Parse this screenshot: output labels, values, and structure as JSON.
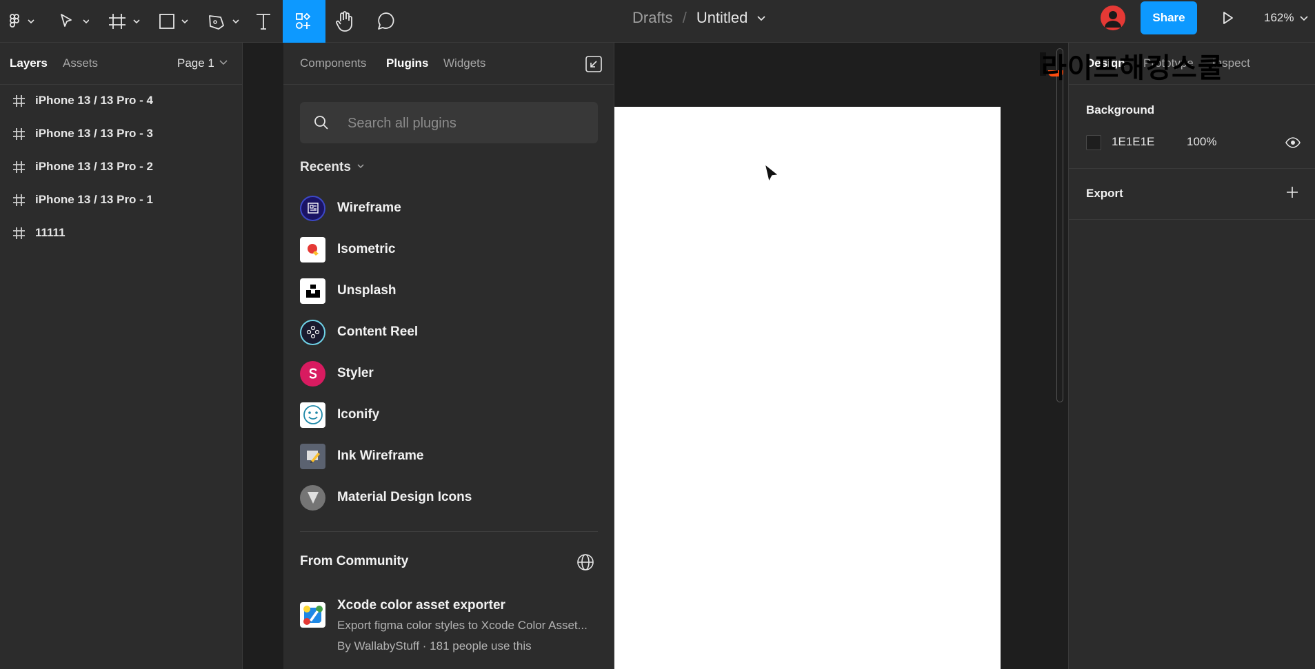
{
  "toolbar": {
    "file_breadcrumb": "Drafts",
    "file_name": "Untitled",
    "share_label": "Share",
    "zoom": "162%",
    "tools": [
      "main-menu-icon",
      "move-icon",
      "frame-icon",
      "rectangle-icon",
      "pen-icon",
      "text-icon",
      "resources-icon",
      "hand-icon",
      "comment-icon"
    ],
    "active_tool": "resources-icon",
    "accent": "#0d99ff"
  },
  "left_panel": {
    "tabs": [
      "Layers",
      "Assets"
    ],
    "page": "Page 1",
    "layers": [
      "iPhone 13 / 13 Pro - 4",
      "iPhone 13 / 13 Pro - 3",
      "iPhone 13 / 13 Pro - 2",
      "iPhone 13 / 13 Pro - 1",
      "11111"
    ]
  },
  "plugins_panel": {
    "tabs": [
      "Components",
      "Plugins",
      "Widgets"
    ],
    "active_tab": "Plugins",
    "search_placeholder": "Search all plugins",
    "recents_label": "Recents",
    "recents": [
      "Wireframe",
      "Isometric",
      "Unsplash",
      "Content Reel",
      "Styler",
      "Iconify",
      "Ink Wireframe",
      "Material Design Icons"
    ],
    "community_label": "From Community",
    "community_plugin": {
      "title": "Xcode color asset exporter",
      "description": "Export figma color styles to Xcode Color Asset...",
      "byline": "By WallabyStuff · 181 people use this"
    }
  },
  "right_panel": {
    "tabs": [
      "Design",
      "Prototype",
      "Inspect"
    ],
    "active_tab": "Design",
    "watermark": "라이프해킹스쿨",
    "background_label": "Background",
    "background_hex": "1E1E1E",
    "background_opacity": "100%",
    "export_label": "Export"
  }
}
